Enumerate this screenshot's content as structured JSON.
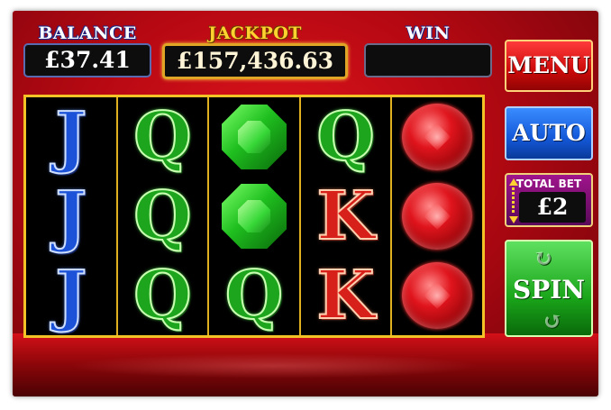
{
  "balance": {
    "label": "BALANCE",
    "value": "£37.41"
  },
  "jackpot": {
    "label": "JACKPOT",
    "value": "£157,436.63"
  },
  "win": {
    "label": "WIN",
    "value": ""
  },
  "buttons": {
    "menu": "MENU",
    "auto": "AUTO",
    "spin": "SPIN"
  },
  "bet": {
    "label": "TOTAL BET",
    "value": "£2"
  },
  "reels": [
    [
      "J",
      "J",
      "J"
    ],
    [
      "Q",
      "Q",
      "Q"
    ],
    [
      "emerald",
      "emerald",
      "Q"
    ],
    [
      "Q",
      "K",
      "K"
    ],
    [
      "ruby",
      "ruby",
      "ruby"
    ]
  ],
  "colors": {
    "reel_border": "#f2c227",
    "background": "#b40812"
  },
  "icons": {
    "spin_arrows": "refresh-arrows-icon",
    "bet_adjust": "bet-adjust-arrows-icon"
  }
}
